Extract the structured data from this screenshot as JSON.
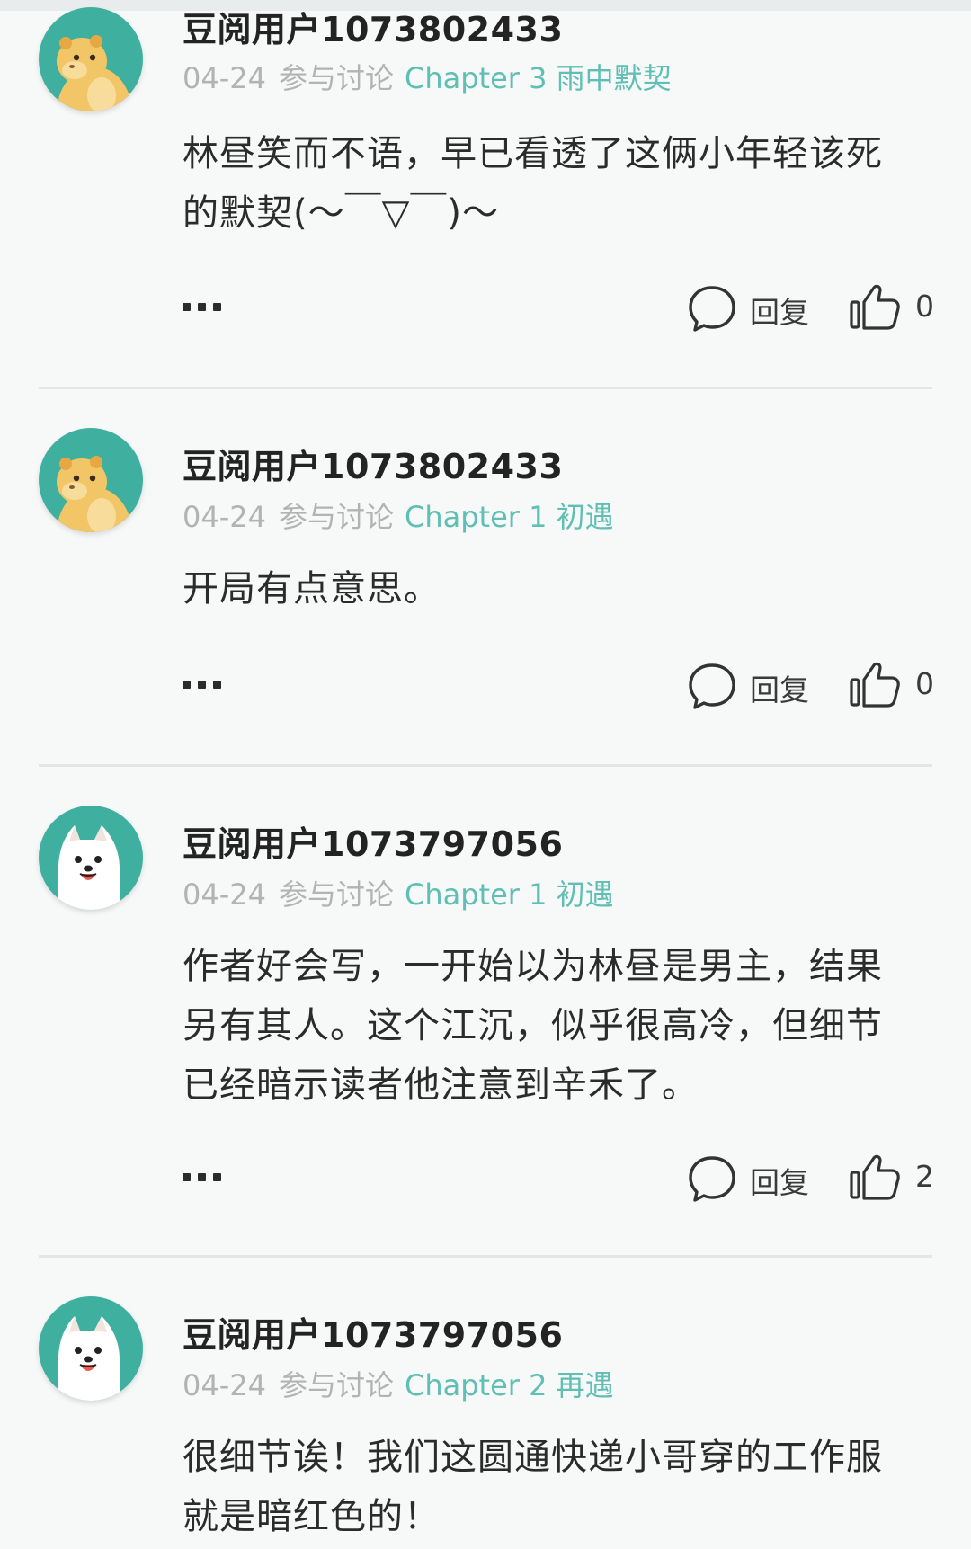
{
  "colors": {
    "accent": "#5fbfb4",
    "avatar_bg": "#3fb0a0",
    "muted": "#b3b3b3"
  },
  "comments": [
    {
      "avatar": "hamster-avatar",
      "username": "豆阅用户1073802433",
      "date": "04-24",
      "verb": "参与讨论",
      "chapter": "Chapter 3 雨中默契",
      "lines": [
        "林昼笑而不语，早已看透了这俩小年轻该死",
        "的默契(～￣▽￣)～"
      ],
      "reply_label": "回复",
      "likes": "0"
    },
    {
      "avatar": "hamster-avatar",
      "username": "豆阅用户1073802433",
      "date": "04-24",
      "verb": "参与讨论",
      "chapter": "Chapter 1 初遇",
      "lines": [
        "开局有点意思。"
      ],
      "reply_label": "回复",
      "likes": "0"
    },
    {
      "avatar": "samoyed-avatar",
      "username": "豆阅用户1073797056",
      "date": "04-24",
      "verb": "参与讨论",
      "chapter": "Chapter 1 初遇",
      "lines": [
        "作者好会写，一开始以为林昼是男主，结果",
        "另有其人。这个江沉，似乎很高冷，但细节",
        "已经暗示读者他注意到辛禾了。"
      ],
      "reply_label": "回复",
      "likes": "2"
    },
    {
      "avatar": "samoyed-avatar",
      "username": "豆阅用户1073797056",
      "date": "04-24",
      "verb": "参与讨论",
      "chapter": "Chapter 2 再遇",
      "lines": [
        "很细节诶！我们这圆通快递小哥穿的工作服",
        "就是暗红色的！"
      ]
    }
  ]
}
